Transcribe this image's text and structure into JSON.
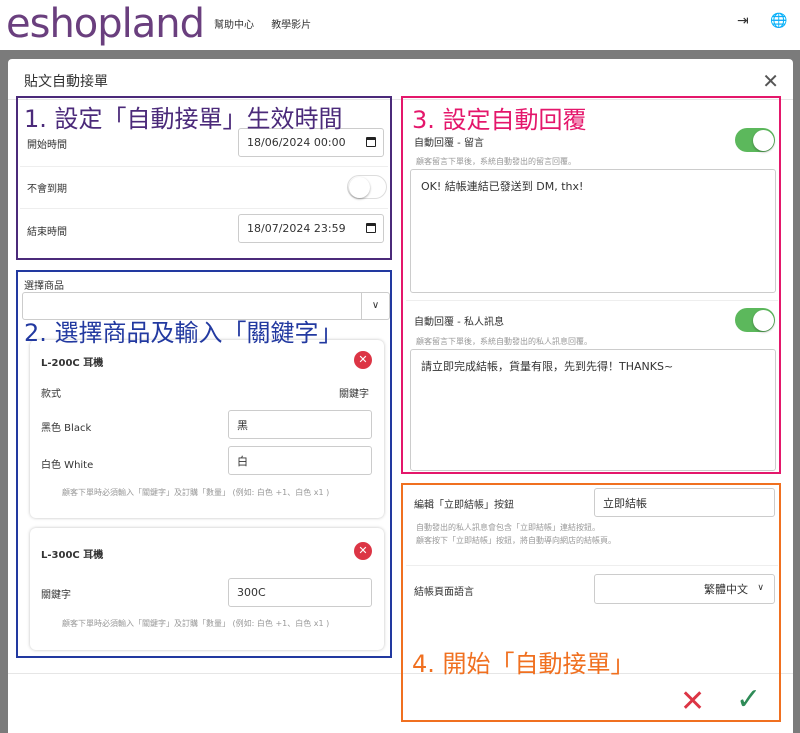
{
  "header": {
    "logo": "eshopland",
    "nav": [
      "幫助中心",
      "教學影片"
    ]
  },
  "modal": {
    "title": "貼文自動接單",
    "close": "✕"
  },
  "annotations": {
    "one": "1. 設定「自動接單」生效時間",
    "two": "2. 選擇商品及輸入「關鍵字」",
    "three": "3. 設定自動回覆",
    "four": "4. 開始「自動接單」"
  },
  "schedule": {
    "start_label": "開始時間",
    "start_value": "18/06/2024 00:00",
    "no_expiry_label": "不會到期",
    "no_expiry_on": false,
    "end_label": "結束時間",
    "end_value": "18/07/2024 23:59"
  },
  "products": {
    "select_label": "選擇商品",
    "items": [
      {
        "name": "L-200C 耳機",
        "col_left": "款式",
        "col_right": "關鍵字",
        "variants": [
          {
            "label": "黑色 Black",
            "keyword": "黑"
          },
          {
            "label": "白色 White",
            "keyword": "白"
          }
        ],
        "hint": "顧客下單時必須輸入「關鍵字」及訂購「數量」 (例如: 白色 +1、白色 x1 )"
      },
      {
        "name": "L-300C 耳機",
        "keyword_label": "關鍵字",
        "keyword": "300C",
        "hint": "顧客下單時必須輸入「關鍵字」及訂購「數量」 (例如: 白色 +1、白色 x1 )"
      }
    ]
  },
  "auto_reply": {
    "comment_label": "自動回覆 - 留言",
    "comment_on": true,
    "comment_hint": "顧客留言下單後，系統自動發出的留言回覆。",
    "comment_text": "OK! 結帳連結已發送到 DM, thx!",
    "dm_label": "自動回覆 - 私人訊息",
    "dm_on": true,
    "dm_hint": "顧客留言下單後，系統自動發出的私人訊息回覆。",
    "dm_text": "請立即完成結帳，貨量有限，先到先得！THANKS~"
  },
  "checkout": {
    "button_label": "編輯「立即結帳」按鈕",
    "button_value": "立即結帳",
    "hint_line1": "自動發出的私人訊息會包含「立即結帳」連結按鈕。",
    "hint_line2": "顧客按下「立即結帳」按鈕，將自動導向網店的結帳頁。",
    "language_label": "結帳頁面語言",
    "language_value": "繁體中文"
  },
  "footer": {
    "cancel": "✕",
    "confirm": "✓"
  },
  "colors": {
    "annotation_1": "#4b2a7a",
    "annotation_2": "#2239a0",
    "annotation_3": "#e4176b",
    "annotation_4": "#f07020",
    "toggle_on": "#5cb85c",
    "danger": "#dc3545",
    "confirm": "#2e8b57"
  }
}
